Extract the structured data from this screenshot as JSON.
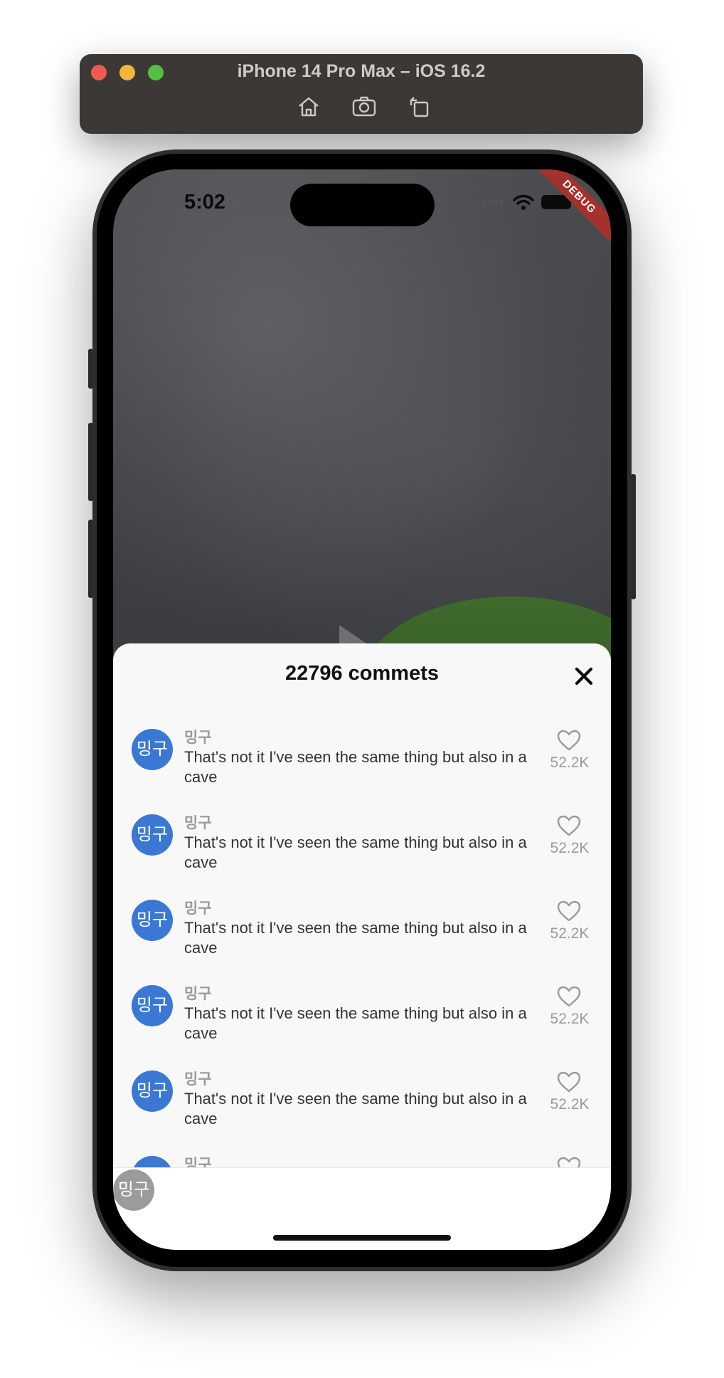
{
  "window": {
    "title": "iPhone 14 Pro Max – iOS 16.2"
  },
  "toolbar": {
    "home_icon": "home-icon",
    "screenshot_icon": "camera-icon",
    "rotate_icon": "rotate-icon"
  },
  "status_bar": {
    "time": "5:02",
    "debug_label": "DEBUG"
  },
  "sheet": {
    "title": "22796 commets",
    "comments": [
      {
        "avatar": "밍구",
        "username": "밍구",
        "text": "That's not it I've seen the same thing but also in a cave",
        "likes": "52.2K"
      },
      {
        "avatar": "밍구",
        "username": "밍구",
        "text": "That's not it I've seen the same thing but also in a cave",
        "likes": "52.2K"
      },
      {
        "avatar": "밍구",
        "username": "밍구",
        "text": "That's not it I've seen the same thing but also in a cave",
        "likes": "52.2K"
      },
      {
        "avatar": "밍구",
        "username": "밍구",
        "text": "That's not it I've seen the same thing but also in a cave",
        "likes": "52.2K"
      },
      {
        "avatar": "밍구",
        "username": "밍구",
        "text": "That's not it I've seen the same thing but also in a cave",
        "likes": "52.2K"
      },
      {
        "avatar": "밍구",
        "username": "밍구",
        "text": "",
        "likes": ""
      }
    ],
    "composer_avatar": "밍구"
  },
  "colors": {
    "avatar_blue": "#3a78d4",
    "debug_red": "#a4312b",
    "muted_gray": "#9a9a9a"
  }
}
